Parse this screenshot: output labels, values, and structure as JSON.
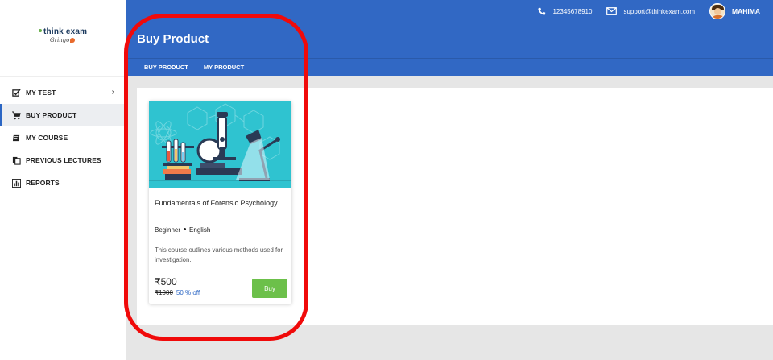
{
  "logo": {
    "brand": "think exam",
    "tagline": "Gringo"
  },
  "sidebar": {
    "items": [
      {
        "label": "MY TEST",
        "icon": "checkbox-icon",
        "has_submenu": true
      },
      {
        "label": "BUY PRODUCT",
        "icon": "cart-icon",
        "active": true
      },
      {
        "label": "MY COURSE",
        "icon": "book-icon"
      },
      {
        "label": "PREVIOUS LECTURES",
        "icon": "copy-icon"
      },
      {
        "label": "REPORTS",
        "icon": "bar-chart-icon"
      }
    ]
  },
  "header": {
    "phone": "12345678910",
    "email": "support@thinkexam.com",
    "user_name": "MAHIMA",
    "page_title": "Buy Product",
    "tabs": [
      {
        "label": "BUY PRODUCT"
      },
      {
        "label": "MY PRODUCT"
      }
    ]
  },
  "product": {
    "title": "Fundamentals of Forensic Psychology",
    "level": "Beginner",
    "language": "English",
    "description": "This course outlines various methods used for investigation.",
    "price": "₹500",
    "original_price": "₹1000",
    "discount": "50 % off",
    "buy_label": "Buy",
    "image": "laboratory-microscope-illustration"
  },
  "colors": {
    "header_bg": "#3168c4",
    "active_border": "#2b66c4",
    "buy_button": "#6cc04a",
    "card_image_bg": "#2fc3d0",
    "annotation": "#f00a0a"
  }
}
